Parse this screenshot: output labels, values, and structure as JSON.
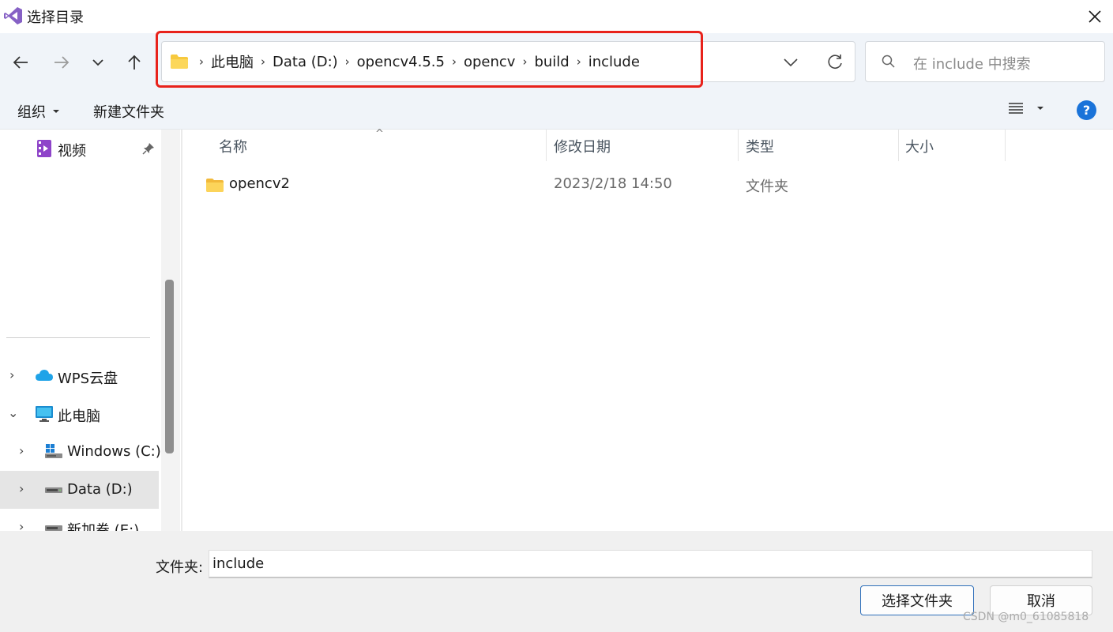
{
  "window": {
    "title": "选择目录"
  },
  "address_bar": {
    "crumbs": [
      "此电脑",
      "Data (D:)",
      "opencv4.5.5",
      "opencv",
      "build",
      "include"
    ]
  },
  "search": {
    "placeholder": "在 include 中搜索"
  },
  "command_bar": {
    "organize_label": "组织",
    "new_folder_label": "新建文件夹"
  },
  "nav_pane": {
    "items": [
      {
        "label": "视频"
      },
      {
        "label": "WPS云盘"
      },
      {
        "label": "此电脑"
      },
      {
        "label": "Windows (C:)"
      },
      {
        "label": "Data (D:)"
      },
      {
        "label": "新加卷 (E:)"
      }
    ]
  },
  "file_list": {
    "columns": [
      "名称",
      "修改日期",
      "类型",
      "大小"
    ],
    "rows": [
      {
        "name": "opencv2",
        "modified": "2023/2/18 14:50",
        "type": "文件夹",
        "size": ""
      }
    ]
  },
  "footer": {
    "folder_label": "文件夹:",
    "folder_value": "include",
    "select_button": "选择文件夹",
    "cancel_button": "取消",
    "watermark": "CSDN @m0_61085818"
  },
  "colors": {
    "highlight": "#e8221b",
    "accent": "#1a73d9"
  }
}
